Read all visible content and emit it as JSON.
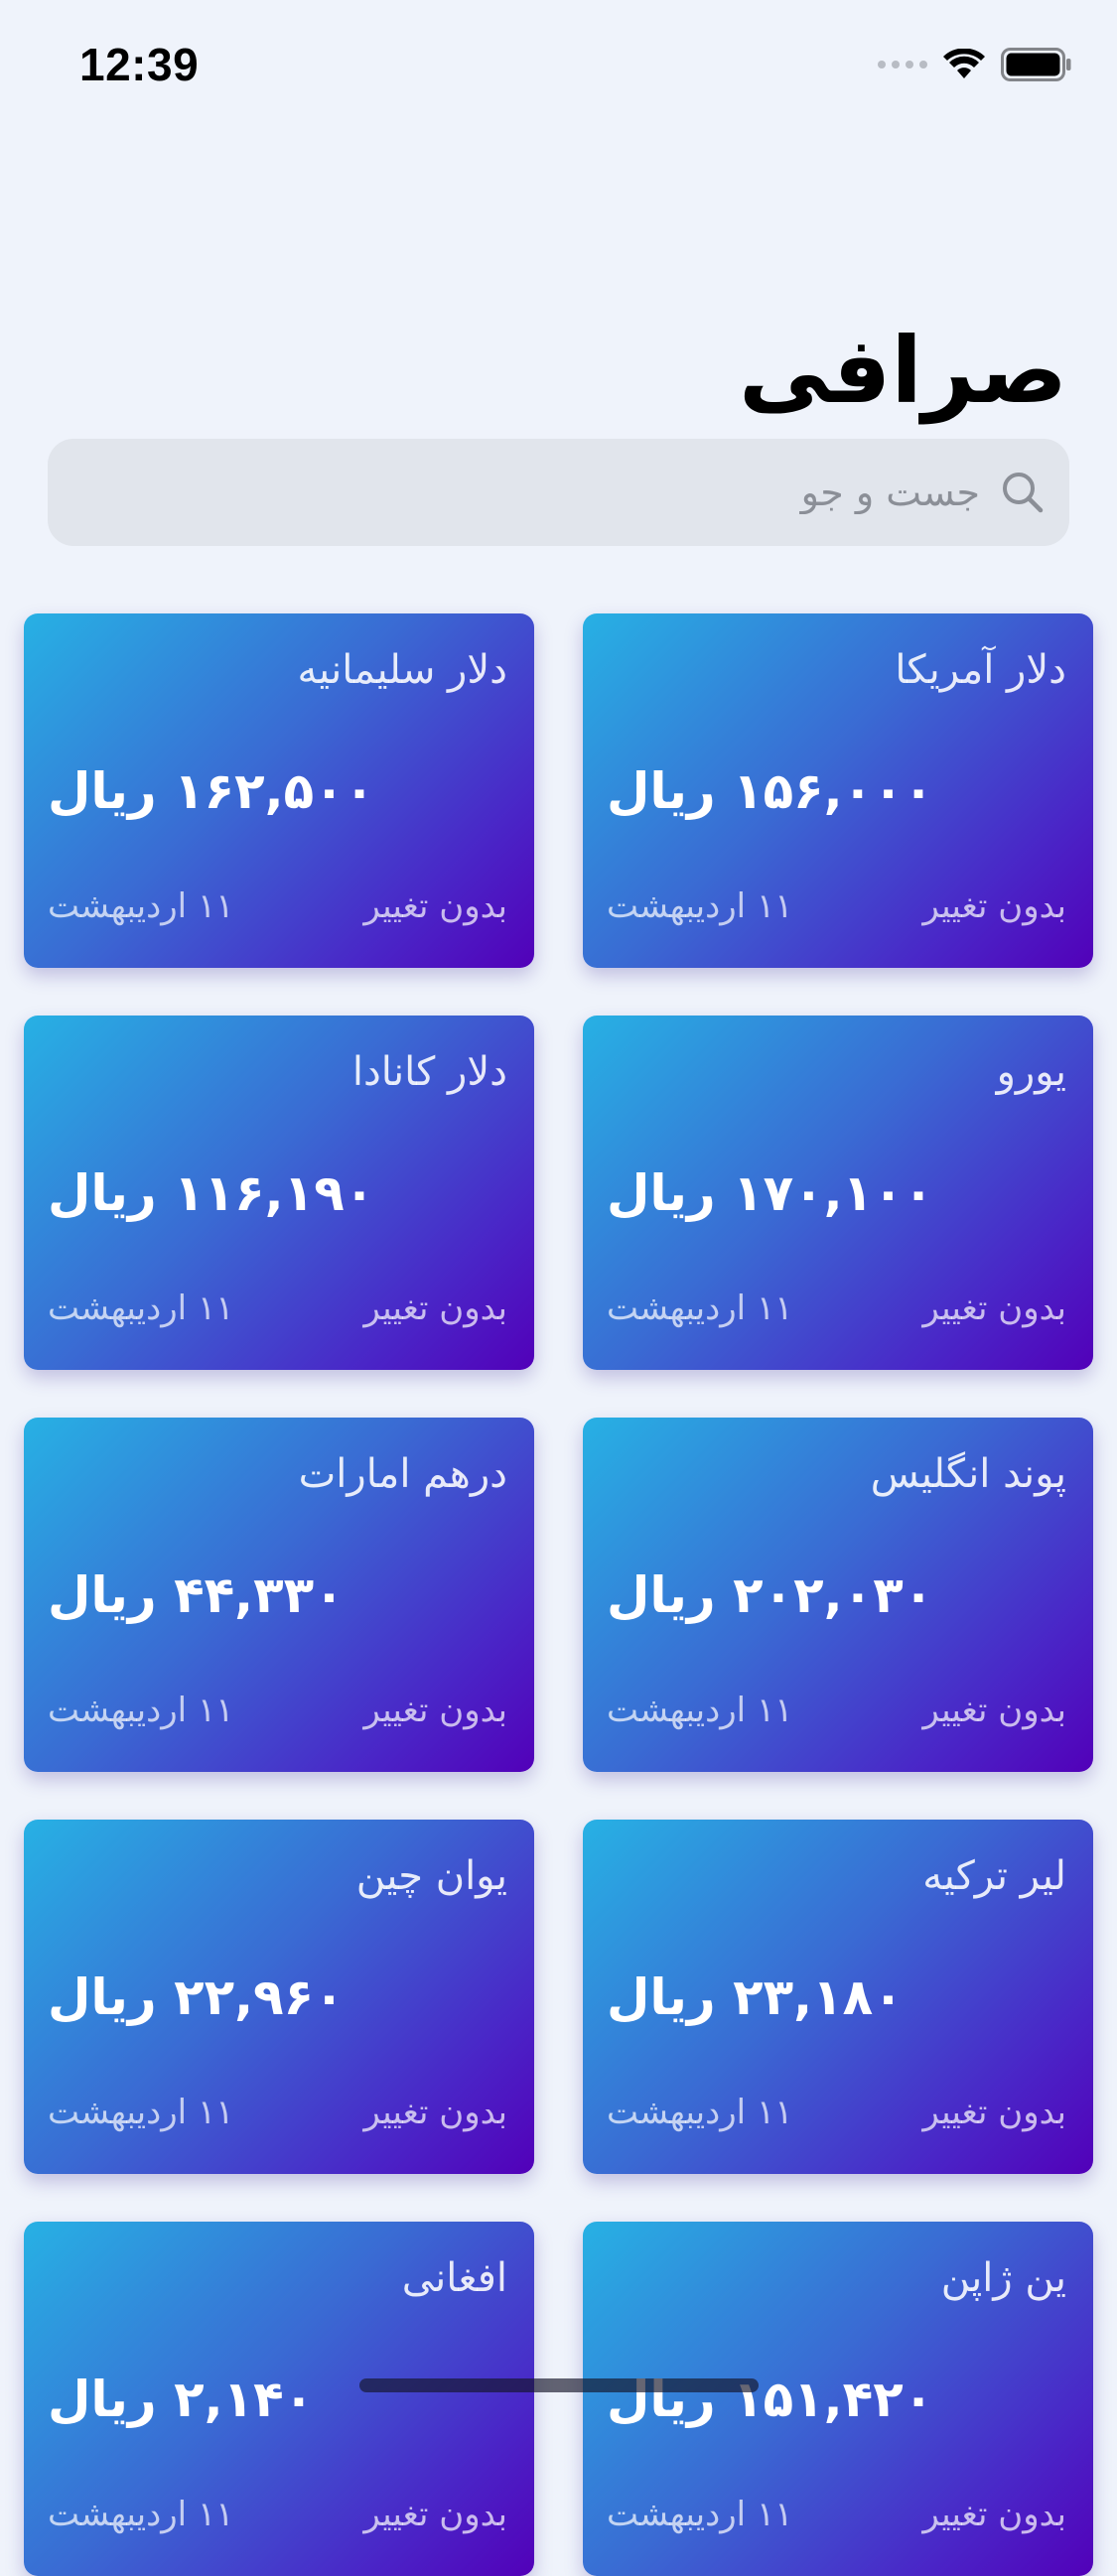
{
  "status_bar": {
    "time": "12:39"
  },
  "nav": {
    "title": "صرافی"
  },
  "search": {
    "placeholder": "جست و جو",
    "value": ""
  },
  "currencies": [
    {
      "name": "دلار آمریکا",
      "price": "۱۵۶,۰۰۰ ریال",
      "change": "بدون تغییر",
      "date": "۱۱ اردیبهشت"
    },
    {
      "name": "دلار سلیمانیه",
      "price": "۱۶۲,۵۰۰ ریال",
      "change": "بدون تغییر",
      "date": "۱۱ اردیبهشت"
    },
    {
      "name": "یورو",
      "price": "۱۷۰,۱۰۰ ریال",
      "change": "بدون تغییر",
      "date": "۱۱ اردیبهشت"
    },
    {
      "name": "دلار کانادا",
      "price": "۱۱۶,۱۹۰ ریال",
      "change": "بدون تغییر",
      "date": "۱۱ اردیبهشت"
    },
    {
      "name": "پوند انگلیس",
      "price": "۲۰۲,۰۳۰ ریال",
      "change": "بدون تغییر",
      "date": "۱۱ اردیبهشت"
    },
    {
      "name": "درهم امارات",
      "price": "۴۴,۳۳۰ ریال",
      "change": "بدون تغییر",
      "date": "۱۱ اردیبهشت"
    },
    {
      "name": "لیر ترکیه",
      "price": "۲۳,۱۸۰ ریال",
      "change": "بدون تغییر",
      "date": "۱۱ اردیبهشت"
    },
    {
      "name": "یوان چین",
      "price": "۲۲,۹۶۰ ریال",
      "change": "بدون تغییر",
      "date": "۱۱ اردیبهشت"
    },
    {
      "name": "ین ژاپن",
      "price": "۱۵۱,۴۲۰ ریال",
      "change": "بدون تغییر",
      "date": "۱۱ اردیبهشت"
    },
    {
      "name": "افغانی",
      "price": "۲,۱۴۰ ریال",
      "change": "بدون تغییر",
      "date": "۱۱ اردیبهشت"
    }
  ]
}
